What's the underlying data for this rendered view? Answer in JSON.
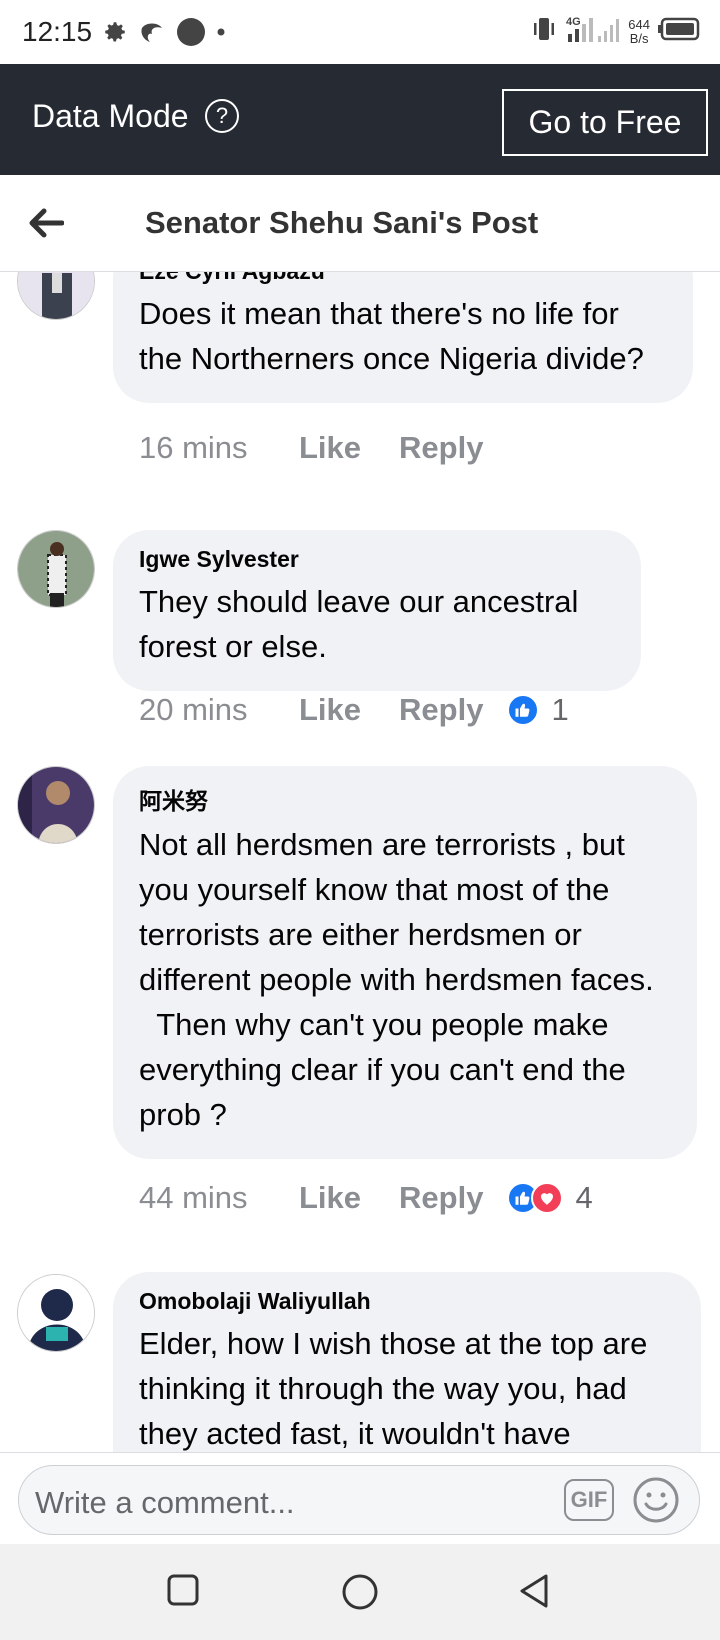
{
  "status_bar": {
    "time": "12:15",
    "network": "4G",
    "speed_value": "644",
    "speed_unit": "B/s"
  },
  "data_mode": {
    "label": "Data Mode",
    "help_icon": "?",
    "go_free_label": "Go to Free"
  },
  "header": {
    "back_icon": "arrow-left-icon",
    "title": "Senator Shehu Sani's Post"
  },
  "comments": [
    {
      "author": "Eze Cyril Agbazu",
      "text": "Does it mean that there's no life for the Northerners once Nigeria divide?",
      "time": "16 mins",
      "like": "Like",
      "reply": "Reply",
      "reactions": ""
    },
    {
      "author": "Igwe Sylvester",
      "text": "They should leave our ancestral forest or else.",
      "time": "20 mins",
      "like": "Like",
      "reply": "Reply",
      "reactions": "1"
    },
    {
      "author": "阿米努",
      "text": "Not all herdsmen are terrorists , but you yourself know that most of the terrorists are either herdsmen or different people with herdsmen faces.\n  Then why can't you people make everything clear if you can't end the prob ?",
      "time": "44 mins",
      "like": "Like",
      "reply": "Reply",
      "reactions": "4"
    },
    {
      "author": "Omobolaji Waliyullah",
      "text": "Elder, how I wish those at the top are thinking it through the way you, had they acted fast, it wouldn't have",
      "time": "",
      "like": "",
      "reply": "",
      "reactions": ""
    }
  ],
  "composer": {
    "placeholder": "Write a comment...",
    "gif_label": "GIF"
  },
  "colors": {
    "data_mode_bg": "#262a33",
    "bubble_bg": "#f0f2f5",
    "like_blue": "#1877f2",
    "love_red": "#f33e58"
  }
}
